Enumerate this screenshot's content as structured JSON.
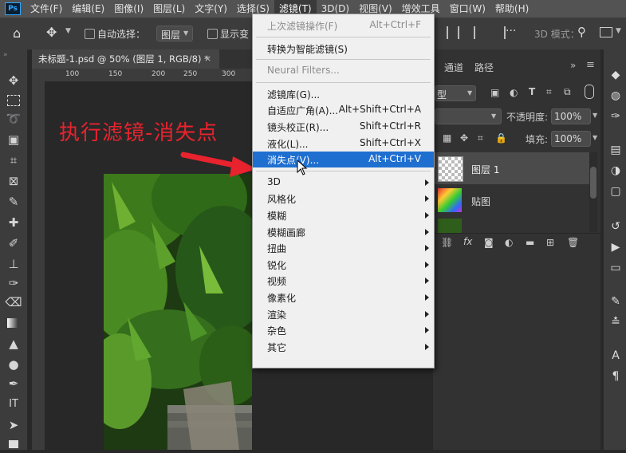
{
  "app_logo": "Ps",
  "menubar": [
    "文件(F)",
    "编辑(E)",
    "图像(I)",
    "图层(L)",
    "文字(Y)",
    "选择(S)",
    "滤镜(T)",
    "3D(D)",
    "视图(V)",
    "增效工具",
    "窗口(W)",
    "帮助(H)"
  ],
  "active_menu": "滤镜(T)",
  "options": {
    "auto_select_label": "自动选择：",
    "auto_select_value": "图层",
    "show_transform_label": "显示变",
    "three_d_mode_label": "3D 模式："
  },
  "document_tab": "未标题-1.psd @ 50% (图层 1, RGB/8) *",
  "ruler_ticks": [
    "100",
    "150",
    "200",
    "250",
    "300"
  ],
  "filter_menu": {
    "items": [
      {
        "label": "上次滤镜操作(F)",
        "shortcut": "Alt+Ctrl+F",
        "disabled": true
      },
      {
        "sep": true
      },
      {
        "label": "转换为智能滤镜(S)",
        "shortcut": ""
      },
      {
        "sep": true
      },
      {
        "label": "Neural Filters...",
        "shortcut": "",
        "disabled": true
      },
      {
        "sep": true
      },
      {
        "label": "滤镜库(G)...",
        "shortcut": ""
      },
      {
        "label": "自适应广角(A)...",
        "shortcut": "Alt+Shift+Ctrl+A"
      },
      {
        "label": "镜头校正(R)...",
        "shortcut": "Shift+Ctrl+R"
      },
      {
        "label": "液化(L)...",
        "shortcut": "Shift+Ctrl+X"
      },
      {
        "label": "消失点(V)...",
        "shortcut": "Alt+Ctrl+V",
        "highlighted": true
      },
      {
        "sep": true
      },
      {
        "label": "3D",
        "submenu": true
      },
      {
        "label": "风格化",
        "submenu": true
      },
      {
        "label": "模糊",
        "submenu": true
      },
      {
        "label": "模糊画廊",
        "submenu": true
      },
      {
        "label": "扭曲",
        "submenu": true
      },
      {
        "label": "锐化",
        "submenu": true
      },
      {
        "label": "视频",
        "submenu": true
      },
      {
        "label": "像素化",
        "submenu": true
      },
      {
        "label": "渲染",
        "submenu": true
      },
      {
        "label": "杂色",
        "submenu": true
      },
      {
        "label": "其它",
        "submenu": true
      }
    ]
  },
  "annotation": "执行滤镜-消失点",
  "panels": {
    "tabs": [
      "通道",
      "路径"
    ],
    "kind_value": "型",
    "opacity_label": "不透明度:",
    "opacity_value": "100%",
    "fill_label": "填充:",
    "fill_value": "100%",
    "layers": [
      {
        "name": "图层 1",
        "selected": true
      },
      {
        "name": "贴图",
        "selected": false
      }
    ]
  },
  "colors": {
    "menu_highlight": "#1f6fd0",
    "annotation_red": "#e8232e",
    "ps_blue": "#31a8ff"
  }
}
